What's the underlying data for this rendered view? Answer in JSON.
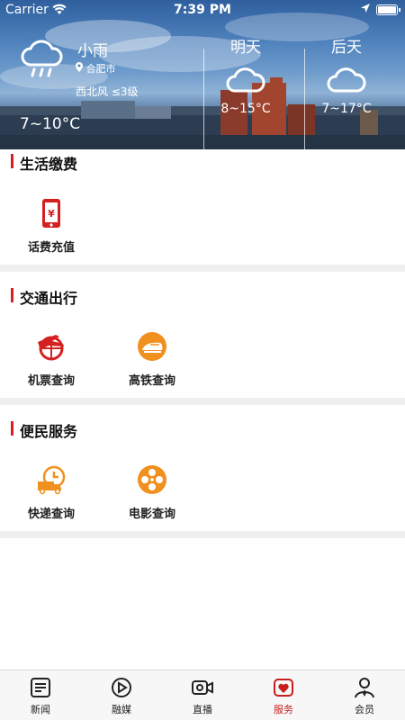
{
  "status_bar": {
    "carrier": "Carrier",
    "time": "7:39 PM"
  },
  "weather": {
    "today": {
      "condition": "小雨",
      "city": "合肥市",
      "wind": "西北风 ≤3级",
      "temp": "7~10°C"
    },
    "forecast": [
      {
        "label": "明天",
        "temp": "8~15°C"
      },
      {
        "label": "后天",
        "temp": "7~17°C"
      }
    ]
  },
  "sections": [
    {
      "title": "生活缴费",
      "items": [
        {
          "label": "话费充值",
          "icon": "phone-recharge-icon"
        }
      ]
    },
    {
      "title": "交通出行",
      "items": [
        {
          "label": "机票查询",
          "icon": "plane-ticket-icon"
        },
        {
          "label": "高铁查询",
          "icon": "high-speed-train-icon"
        }
      ]
    },
    {
      "title": "便民服务",
      "items": [
        {
          "label": "快递查询",
          "icon": "express-delivery-icon"
        },
        {
          "label": "电影查询",
          "icon": "film-reel-icon"
        }
      ]
    }
  ],
  "tabs": [
    {
      "label": "新闻",
      "icon": "news-icon"
    },
    {
      "label": "融媒",
      "icon": "media-icon"
    },
    {
      "label": "直播",
      "icon": "live-camera-icon"
    },
    {
      "label": "服务",
      "icon": "service-heart-icon"
    },
    {
      "label": "会员",
      "icon": "member-icon"
    }
  ],
  "colors": {
    "accent": "#c81e1e",
    "section_bar": "#d42020",
    "service_orange": "#f0901e"
  }
}
